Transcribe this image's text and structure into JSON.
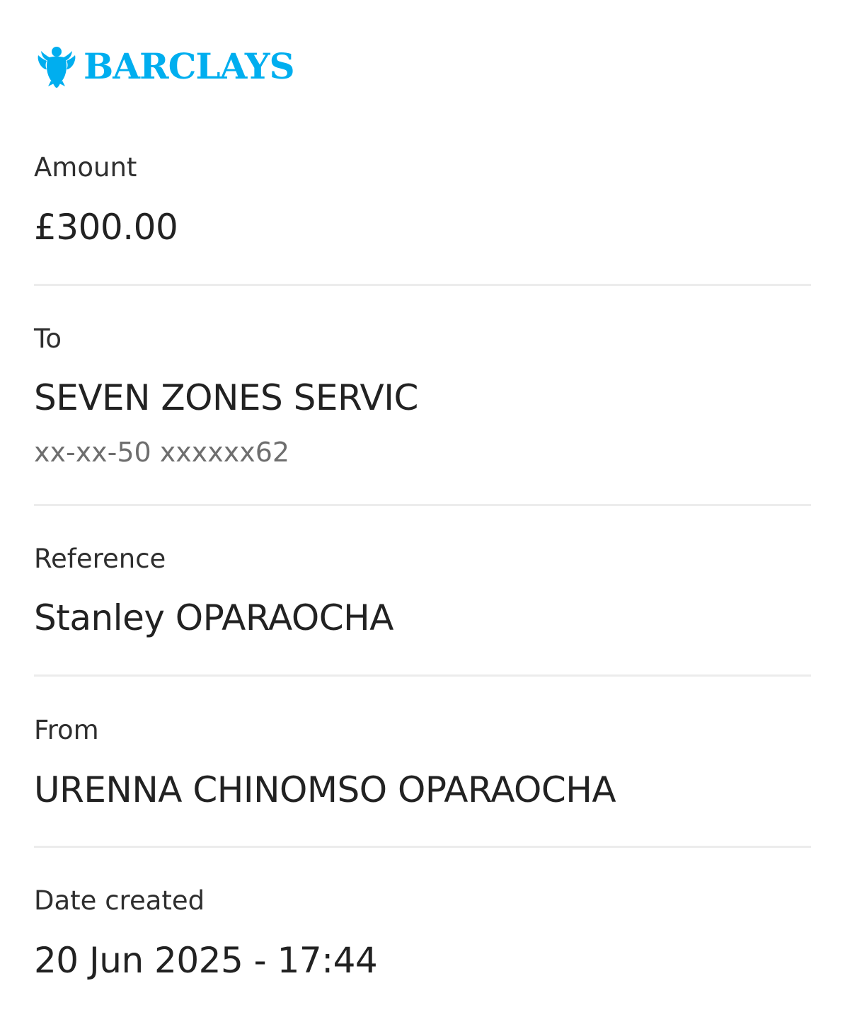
{
  "brand": {
    "name": "BARCLAYS",
    "color": "#00aeef",
    "icon": "eagle-icon"
  },
  "details": {
    "amount": {
      "label": "Amount",
      "value": "£300.00"
    },
    "to": {
      "label": "To",
      "value": "SEVEN ZONES SERVIC",
      "account": "xx-xx-50 xxxxxx62"
    },
    "reference": {
      "label": "Reference",
      "value": "Stanley OPARAOCHA"
    },
    "from": {
      "label": "From",
      "value": "URENNA CHINOMSO OPARAOCHA"
    },
    "date_created": {
      "label": "Date created",
      "value": "20 Jun 2025 - 17:44"
    }
  },
  "colors": {
    "text": "#222222",
    "muted": "#6e6e6e",
    "divider": "#ececec"
  }
}
